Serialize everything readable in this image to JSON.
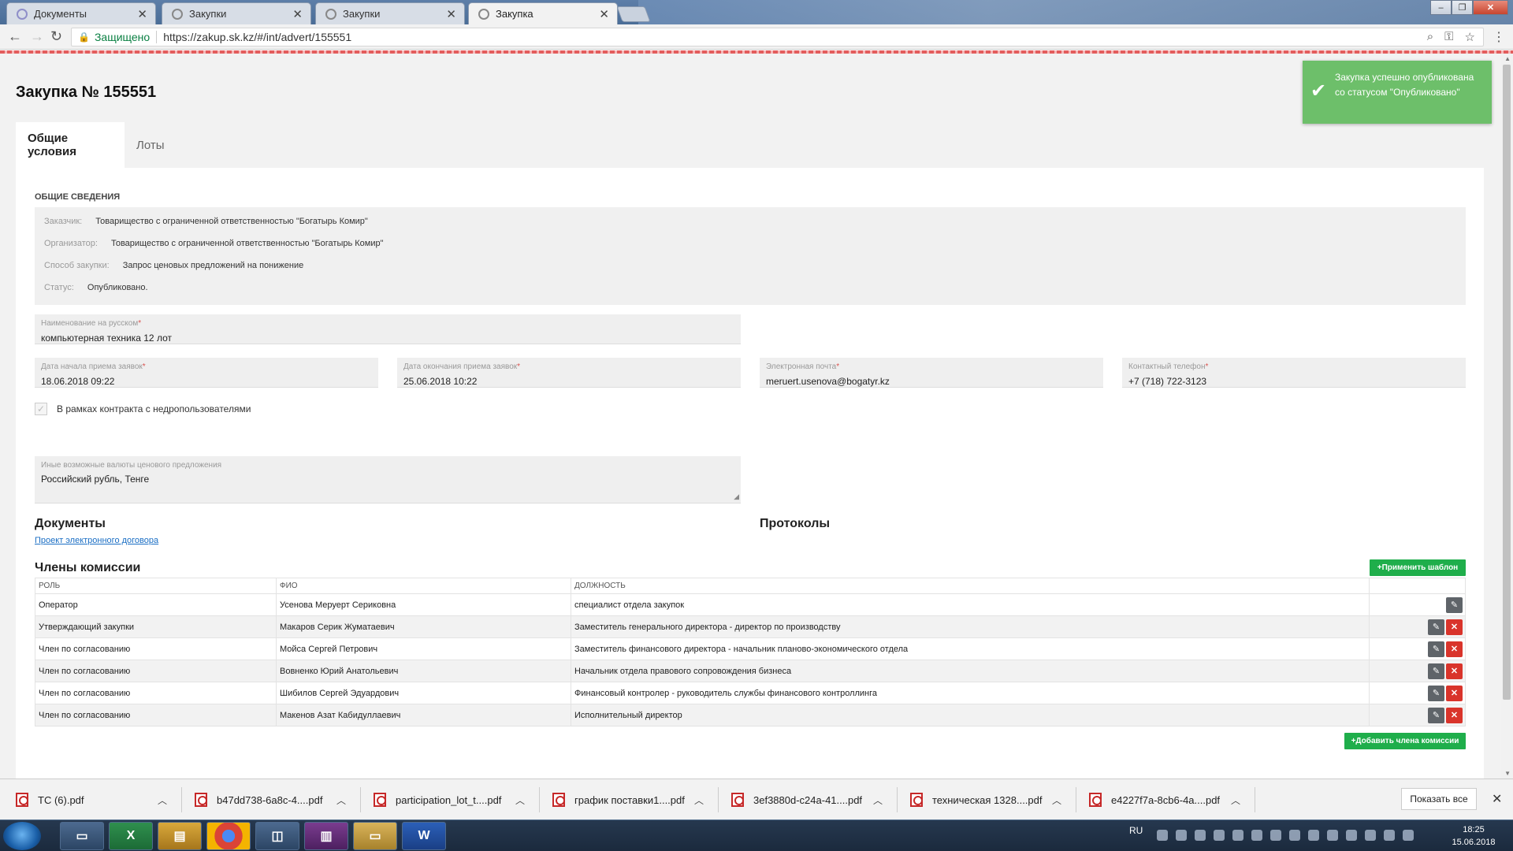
{
  "browser": {
    "tabs": [
      {
        "title": "Документы"
      },
      {
        "title": "Закупки"
      },
      {
        "title": "Закупки"
      },
      {
        "title": "Закупка"
      }
    ],
    "secure_label": "Защищено",
    "url": "https://zakup.sk.kz/#/int/advert/155551"
  },
  "page": {
    "title": "Закупка № 155551",
    "tabs": [
      "Общие условия",
      "Лоты"
    ],
    "general_caption": "ОБЩИЕ СВЕДЕНИЯ",
    "info": [
      {
        "key": "Заказчик:",
        "value": "Товарищество с ограниченной ответственностью \"Богатырь Комир\""
      },
      {
        "key": "Организатор:",
        "value": "Товарищество с ограниченной ответственностью \"Богатырь Комир\""
      },
      {
        "key": "Способ закупки:",
        "value": "Запрос ценовых предложений на понижение"
      },
      {
        "key": "Статус:",
        "value": "Опубликовано."
      }
    ],
    "fields": {
      "name": {
        "label": "Наименование на русском",
        "value": "компьютерная техника 12 лот"
      },
      "start_date": {
        "label": "Дата начала приема заявок",
        "value": "18.06.2018 09:22"
      },
      "end_date": {
        "label": "Дата окончания приема заявок",
        "value": "25.06.2018 10:22"
      },
      "email": {
        "label": "Электронная почта",
        "value": "meruert.usenova@bogatyr.kz"
      },
      "phone": {
        "label": "Контактный телефон",
        "value": "+7 (718) 722-3123"
      },
      "currencies": {
        "label": "Иные возможные валюты ценового предложения",
        "value": "Российский  рубль, Тенге"
      }
    },
    "required_mark": "*",
    "checkbox_label": "В рамках контракта с недропользователями",
    "documents_heading": "Документы",
    "documents_link": "Проект электронного договора",
    "protocols_heading": "Протоколы",
    "commission": {
      "heading": "Члены комиссии",
      "apply_template_label": "Применить шаблон",
      "add_member_label": "Добавить члена комиссии",
      "columns": [
        "РОЛЬ",
        "ФИО",
        "ДОЛЖНОСТЬ"
      ],
      "rows": [
        {
          "role": "Оператор",
          "name": "Усенова Меруерт Сериковна",
          "position": "специалист отдела закупок"
        },
        {
          "role": "Утверждающий закупки",
          "name": "Макаров Серик Жуматаевич",
          "position": "Заместитель генерального директора - директор по производству"
        },
        {
          "role": "Член по согласованию",
          "name": "Мойса Сергей Петрович",
          "position": "Заместитель финансового директора - начальник планово-экономического отдела"
        },
        {
          "role": "Член по согласованию",
          "name": "Вовненко Юрий Анатольевич",
          "position": "Начальник отдела правового сопровождения бизнеса"
        },
        {
          "role": "Член по согласованию",
          "name": "Шибилов Сергей Эдуардович",
          "position": "Финансовый контролер - руководитель службы финансового контроллинга"
        },
        {
          "role": "Член по согласованию",
          "name": "Макенов Азат Кабидуллаевич",
          "position": "Исполнительный директор"
        }
      ]
    },
    "toast": "Закупка успешно опубликована со статусом \"Опубликовано\""
  },
  "downloads": {
    "items": [
      "TC (6).pdf",
      "b47dd738-6a8c-4....pdf",
      "participation_lot_t....pdf",
      "график поставки1....pdf",
      "3ef3880d-c24a-41....pdf",
      "техническая 1328....pdf",
      "e4227f7a-8cb6-4a....pdf"
    ],
    "show_all": "Показать все"
  },
  "taskbar": {
    "lang": "RU",
    "time": "18:25",
    "date": "15.06.2018"
  },
  "colors": {
    "accent_green": "#1fae4b",
    "toast_green": "#6dbf6a",
    "delete_red": "#d9342b",
    "link_blue": "#1a6ec4"
  }
}
